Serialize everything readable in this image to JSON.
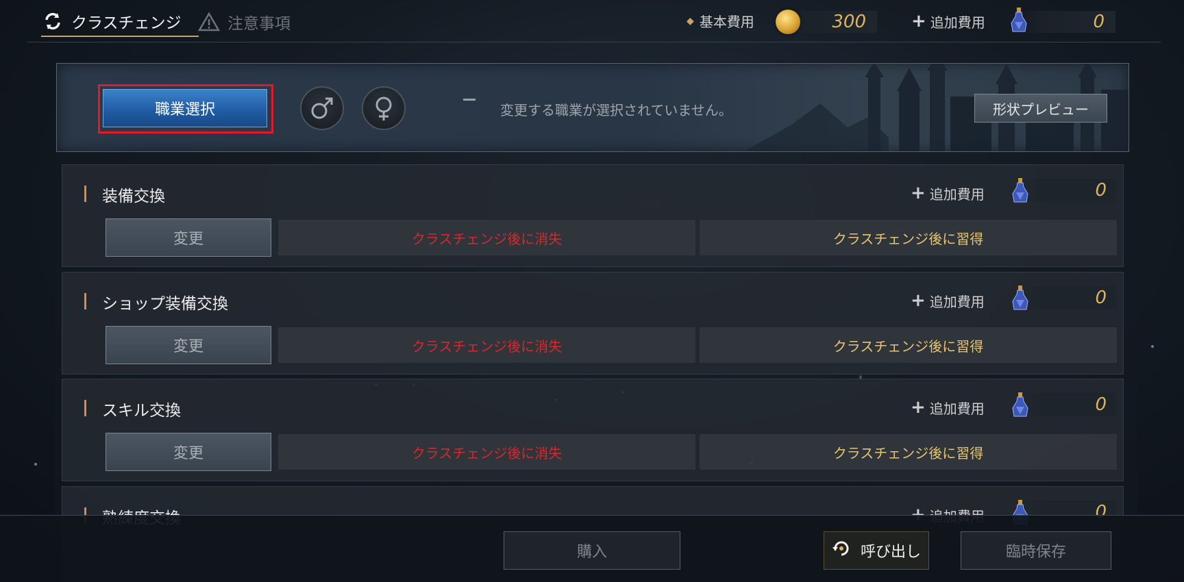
{
  "tabs": [
    {
      "label": "クラスチェンジ",
      "icon": "refresh-icon",
      "active": true
    },
    {
      "label": "注意事項",
      "icon": "warning-icon",
      "active": false
    }
  ],
  "header": {
    "base_cost_label": "基本費用",
    "base_cost_value": "300",
    "base_cost_icon": "gold-coin-icon",
    "extra_cost_label": "追加費用",
    "extra_cost_value": "0",
    "extra_cost_icon": "potion-icon"
  },
  "job_select": {
    "button_label": "職業選択",
    "male_icon": "male-symbol-icon",
    "female_icon": "female-symbol-icon",
    "dash": "−",
    "status_text": "変更する職業が選択されていません。",
    "preview_label": "形状プレビュー"
  },
  "sections": [
    {
      "title": "装備交換",
      "extra_cost_label": "追加費用",
      "extra_cost_value": "0",
      "button_label": "変更",
      "lost_label": "クラスチェンジ後に消失",
      "gain_label": "クラスチェンジ後に習得"
    },
    {
      "title": "ショップ装備交換",
      "extra_cost_label": "追加費用",
      "extra_cost_value": "0",
      "button_label": "変更",
      "lost_label": "クラスチェンジ後に消失",
      "gain_label": "クラスチェンジ後に習得"
    },
    {
      "title": "スキル交換",
      "extra_cost_label": "追加費用",
      "extra_cost_value": "0",
      "button_label": "変更",
      "lost_label": "クラスチェンジ後に消失",
      "gain_label": "クラスチェンジ後に習得"
    },
    {
      "title": "熟練度交換",
      "extra_cost_label": "追加費用",
      "extra_cost_value": "0"
    }
  ],
  "footer": {
    "buy_label": "購入",
    "recall_label": "呼び出し",
    "recall_icon": "refresh-icon",
    "temp_save_label": "臨時保存"
  },
  "colors": {
    "accent_gold": "#e0b35c",
    "lost_red": "#d8272d",
    "gain_yellow": "#e7c470",
    "highlight_red": "#e0192b",
    "job_button_blue": "#2a6bb6"
  }
}
